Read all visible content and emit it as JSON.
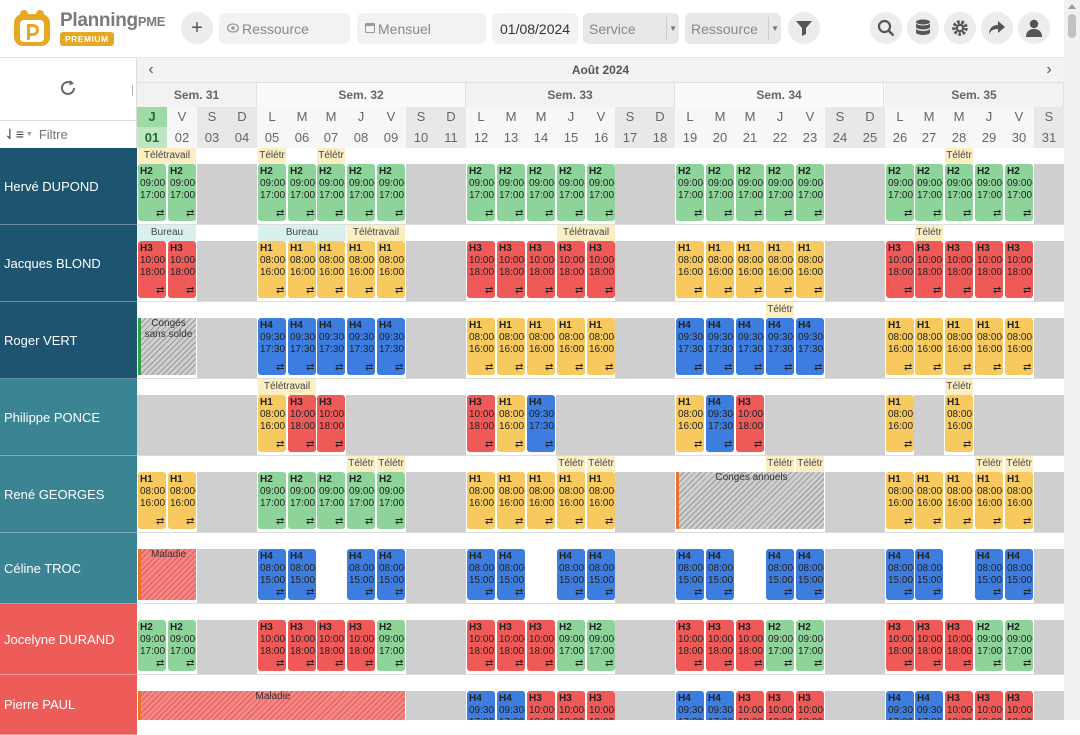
{
  "app": {
    "name": "Planning",
    "name_suffix": "PME",
    "badge": "PREMIUM"
  },
  "toolbar": {
    "resource_placeholder": "Ressource",
    "view_label": "Mensuel",
    "date_value": "01/08/2024",
    "service_label": "Service",
    "resource_select_label": "Ressource"
  },
  "calendar": {
    "month_label": "Août 2024",
    "weeks": [
      "Sem. 31",
      "Sem. 32",
      "Sem. 33",
      "Sem. 34",
      "Sem. 35"
    ],
    "week_start_index": [
      0,
      4,
      11,
      18,
      25
    ],
    "week_length": [
      4,
      7,
      7,
      7,
      6
    ],
    "day_letters": [
      "J",
      "V",
      "S",
      "D",
      "L",
      "M",
      "M",
      "J",
      "V",
      "S",
      "D",
      "L",
      "M",
      "M",
      "J",
      "V",
      "S",
      "D",
      "L",
      "M",
      "M",
      "J",
      "V",
      "S",
      "D",
      "L",
      "M",
      "M",
      "J",
      "V",
      "S"
    ],
    "day_numbers": [
      "01",
      "02",
      "03",
      "04",
      "05",
      "06",
      "07",
      "08",
      "09",
      "10",
      "11",
      "12",
      "13",
      "14",
      "15",
      "16",
      "17",
      "18",
      "19",
      "20",
      "21",
      "22",
      "23",
      "24",
      "25",
      "26",
      "27",
      "28",
      "29",
      "30",
      "31"
    ],
    "today_index": 0,
    "weekend_indices": [
      2,
      3,
      9,
      10,
      16,
      17,
      23,
      24,
      30
    ]
  },
  "filter": {
    "placeholder": "Filtre"
  },
  "legend": {
    "shift_codes": {
      "H1": "08:00-16:00",
      "H2": "09:00-17:00",
      "H3": "10:00-18:00",
      "H4a": "09:30-17:30",
      "H4b": "08:00-15:00"
    },
    "colors": {
      "H1": "#f7c95f",
      "H2": "#8ed39a",
      "H3": "#ef5a58",
      "H4": "#3d7de0",
      "team_dark": "#1d5470",
      "team_mid": "#3b8494",
      "team_red": "#ee5c5a"
    }
  },
  "resources": [
    {
      "name": "Hervé DUPOND",
      "color": "dark",
      "shifts": [
        [
          "H2",
          0
        ],
        [
          "H2",
          1
        ],
        [
          "H2",
          4
        ],
        [
          "H2",
          5
        ],
        [
          "H2",
          6
        ],
        [
          "H2",
          7
        ],
        [
          "H2",
          8
        ],
        [
          "H2",
          11
        ],
        [
          "H2",
          12
        ],
        [
          "H2",
          13
        ],
        [
          "H2",
          14
        ],
        [
          "H2",
          15
        ],
        [
          "H2",
          18
        ],
        [
          "H2",
          19
        ],
        [
          "H2",
          20
        ],
        [
          "H2",
          21
        ],
        [
          "H2",
          22
        ],
        [
          "H2",
          25
        ],
        [
          "H2",
          26
        ],
        [
          "H2",
          27
        ],
        [
          "H2",
          28
        ],
        [
          "H2",
          29
        ]
      ],
      "tags": [
        [
          "Télétravail",
          0,
          2,
          "tt"
        ],
        [
          "Télétr",
          4,
          1,
          "tt"
        ],
        [
          "Télétr",
          6,
          1,
          "tt"
        ],
        [
          "Télétr",
          27,
          1,
          "tt"
        ]
      ]
    },
    {
      "name": "Jacques BLOND",
      "color": "dark",
      "shifts": [
        [
          "H3",
          0
        ],
        [
          "H3",
          1
        ],
        [
          "H1",
          4
        ],
        [
          "H1",
          5
        ],
        [
          "H1",
          6
        ],
        [
          "H1",
          7
        ],
        [
          "H1",
          8
        ],
        [
          "H3",
          11
        ],
        [
          "H3",
          12
        ],
        [
          "H3",
          13
        ],
        [
          "H3",
          14
        ],
        [
          "H3",
          15
        ],
        [
          "H1",
          18
        ],
        [
          "H1",
          19
        ],
        [
          "H1",
          20
        ],
        [
          "H1",
          21
        ],
        [
          "H1",
          22
        ],
        [
          "H3",
          25
        ],
        [
          "H3",
          26
        ],
        [
          "H3",
          27
        ],
        [
          "H3",
          28
        ],
        [
          "H3",
          29
        ]
      ],
      "tags": [
        [
          "Bureau",
          0,
          2,
          "bu"
        ],
        [
          "Bureau",
          4,
          3,
          "bu"
        ],
        [
          "Télétravail",
          7,
          2,
          "tt"
        ],
        [
          "Télétravail",
          14,
          2,
          "tt"
        ],
        [
          "Télétr",
          26,
          1,
          "tt"
        ]
      ]
    },
    {
      "name": "Roger VERT",
      "color": "dark",
      "shifts": [
        [
          "H4",
          4
        ],
        [
          "H4",
          5
        ],
        [
          "H4",
          6
        ],
        [
          "H4",
          7
        ],
        [
          "H4",
          8
        ],
        [
          "H1",
          11
        ],
        [
          "H1",
          12
        ],
        [
          "H1",
          13
        ],
        [
          "H1",
          14
        ],
        [
          "H1",
          15
        ],
        [
          "H4",
          18
        ],
        [
          "H4",
          19
        ],
        [
          "H4",
          20
        ],
        [
          "H4",
          21
        ],
        [
          "H4",
          22
        ],
        [
          "H1",
          25
        ],
        [
          "H1",
          26
        ],
        [
          "H1",
          27
        ],
        [
          "H1",
          28
        ],
        [
          "H1",
          29
        ]
      ],
      "tags": [
        [
          "Télétr",
          21,
          1,
          "tt"
        ]
      ],
      "absence": {
        "label": "Congés sans solde",
        "start": 0,
        "span": 2,
        "style": "grey"
      }
    },
    {
      "name": "Philippe PONCE",
      "color": "mid",
      "shifts": [
        [
          "H1",
          4
        ],
        [
          "H3",
          5
        ],
        [
          "H3",
          6
        ],
        [
          "H3",
          11
        ],
        [
          "H1",
          12
        ],
        [
          "H4",
          13
        ],
        [
          "H1",
          18
        ],
        [
          "H4",
          19
        ],
        [
          "H3",
          20
        ],
        [
          "H1",
          25
        ],
        [
          "H1",
          27
        ]
      ],
      "tags": [
        [
          "Télétravail",
          4,
          2,
          "tt"
        ],
        [
          "Télétr",
          27,
          1,
          "tt"
        ]
      ],
      "greydays": [
        0,
        1,
        2,
        3,
        7,
        8,
        9,
        10,
        14,
        15,
        16,
        17,
        21,
        22,
        23,
        24,
        26,
        28,
        29,
        30
      ]
    },
    {
      "name": "René GEORGES",
      "color": "mid",
      "shifts": [
        [
          "H1",
          0
        ],
        [
          "H1",
          1
        ],
        [
          "H2",
          4
        ],
        [
          "H2",
          5
        ],
        [
          "H2",
          6
        ],
        [
          "H2",
          7
        ],
        [
          "H2",
          8
        ],
        [
          "H1",
          11
        ],
        [
          "H1",
          12
        ],
        [
          "H1",
          13
        ],
        [
          "H1",
          14
        ],
        [
          "H1",
          15
        ],
        [
          "H1",
          25
        ],
        [
          "H1",
          26
        ],
        [
          "H1",
          27
        ],
        [
          "H1",
          28
        ],
        [
          "H1",
          29
        ]
      ],
      "tags": [
        [
          "Télétr",
          7,
          1,
          "tt"
        ],
        [
          "Télétr",
          8,
          1,
          "tt"
        ],
        [
          "Télétr",
          14,
          1,
          "tt"
        ],
        [
          "Télétr",
          15,
          1,
          "tt"
        ],
        [
          "Télétr",
          21,
          1,
          "tt"
        ],
        [
          "Télétr",
          22,
          1,
          "tt"
        ],
        [
          "Télétr",
          28,
          1,
          "tt"
        ],
        [
          "Télétr",
          29,
          1,
          "tt"
        ]
      ],
      "absence": {
        "label": "Congés annuels",
        "start": 18,
        "span": 5,
        "style": "grey"
      }
    },
    {
      "name": "Céline TROC",
      "color": "mid",
      "shifts": [
        [
          "H4",
          4
        ],
        [
          "H4",
          5
        ],
        [
          "H4",
          7
        ],
        [
          "H4",
          8
        ],
        [
          "H4",
          11
        ],
        [
          "H4",
          12
        ],
        [
          "H4",
          14
        ],
        [
          "H4",
          15
        ],
        [
          "H4",
          18
        ],
        [
          "H4",
          19
        ],
        [
          "H4",
          21
        ],
        [
          "H4",
          22
        ],
        [
          "H4",
          25
        ],
        [
          "H4",
          26
        ],
        [
          "H4",
          28
        ],
        [
          "H4",
          29
        ]
      ],
      "tags": [],
      "absence": {
        "label": "Maladie",
        "start": 0,
        "span": 2,
        "style": "red"
      }
    },
    {
      "name": "Jocelyne DURAND",
      "color": "red",
      "shifts": [
        [
          "H2",
          0
        ],
        [
          "H2",
          1
        ],
        [
          "H3",
          4
        ],
        [
          "H3",
          5
        ],
        [
          "H3",
          6
        ],
        [
          "H3",
          7
        ],
        [
          "H2",
          8
        ],
        [
          "H3",
          11
        ],
        [
          "H3",
          12
        ],
        [
          "H3",
          13
        ],
        [
          "H2",
          14
        ],
        [
          "H2",
          15
        ],
        [
          "H3",
          18
        ],
        [
          "H3",
          19
        ],
        [
          "H3",
          20
        ],
        [
          "H2",
          21
        ],
        [
          "H2",
          22
        ],
        [
          "H3",
          25
        ],
        [
          "H3",
          26
        ],
        [
          "H3",
          27
        ],
        [
          "H2",
          28
        ],
        [
          "H2",
          29
        ]
      ],
      "tags": []
    },
    {
      "name": "Pierre PAUL",
      "color": "red",
      "shifts": [
        [
          "H4",
          11
        ],
        [
          "H4",
          12
        ],
        [
          "H3",
          13
        ],
        [
          "H3",
          14
        ],
        [
          "H3",
          15
        ],
        [
          "H4",
          18
        ],
        [
          "H4",
          19
        ],
        [
          "H3",
          20
        ],
        [
          "H3",
          21
        ],
        [
          "H3",
          22
        ],
        [
          "H4",
          25
        ],
        [
          "H4",
          26
        ],
        [
          "H3",
          27
        ],
        [
          "H3",
          28
        ],
        [
          "H3",
          29
        ]
      ],
      "tags": [],
      "absence": {
        "label": "Maladie",
        "start": 0,
        "span": 9,
        "style": "red"
      }
    }
  ]
}
